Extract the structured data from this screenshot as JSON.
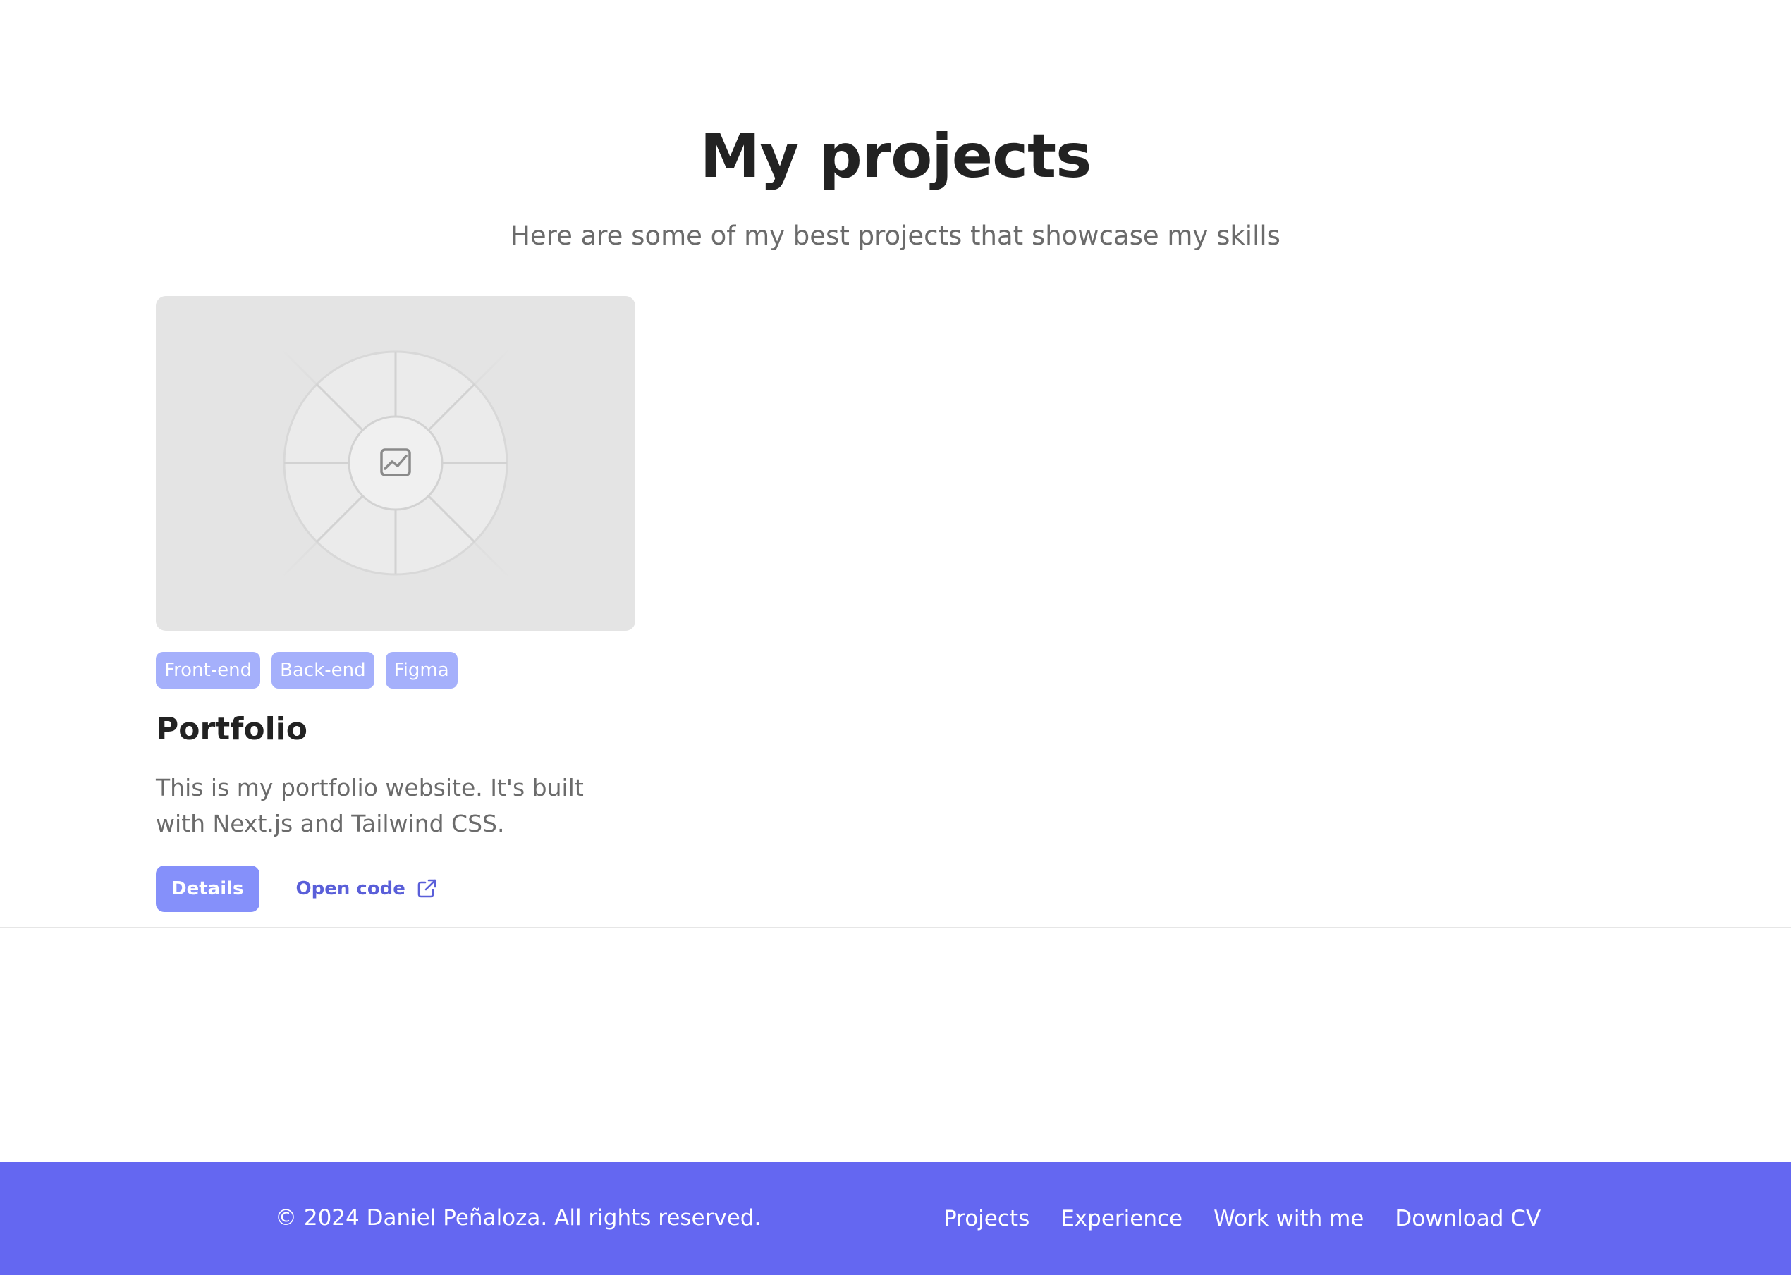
{
  "section": {
    "title": "My projects",
    "subtitle": "Here are some of my best projects that showcase my skills"
  },
  "projects": [
    {
      "tags": [
        "Front-end",
        "Back-end",
        "Figma"
      ],
      "title": "Portfolio",
      "description": "This is my portfolio website. It's built with Next.js and Tailwind CSS.",
      "details_label": "Details",
      "open_code_label": "Open code",
      "image_icon": "image-placeholder-icon",
      "link_icon": "external-link-icon"
    }
  ],
  "footer": {
    "copyright": "© 2024 Daniel Peñaloza. All rights reserved.",
    "links": [
      "Projects",
      "Experience",
      "Work with me",
      "Download CV"
    ]
  },
  "colors": {
    "accent": "#6467f1",
    "tag_bg": "#a5b0fb",
    "button_bg": "#8590fa",
    "link_text": "#5a5fd9",
    "heading": "#222222",
    "muted_text": "#6b6b6b",
    "image_bg": "#e4e4e4"
  }
}
